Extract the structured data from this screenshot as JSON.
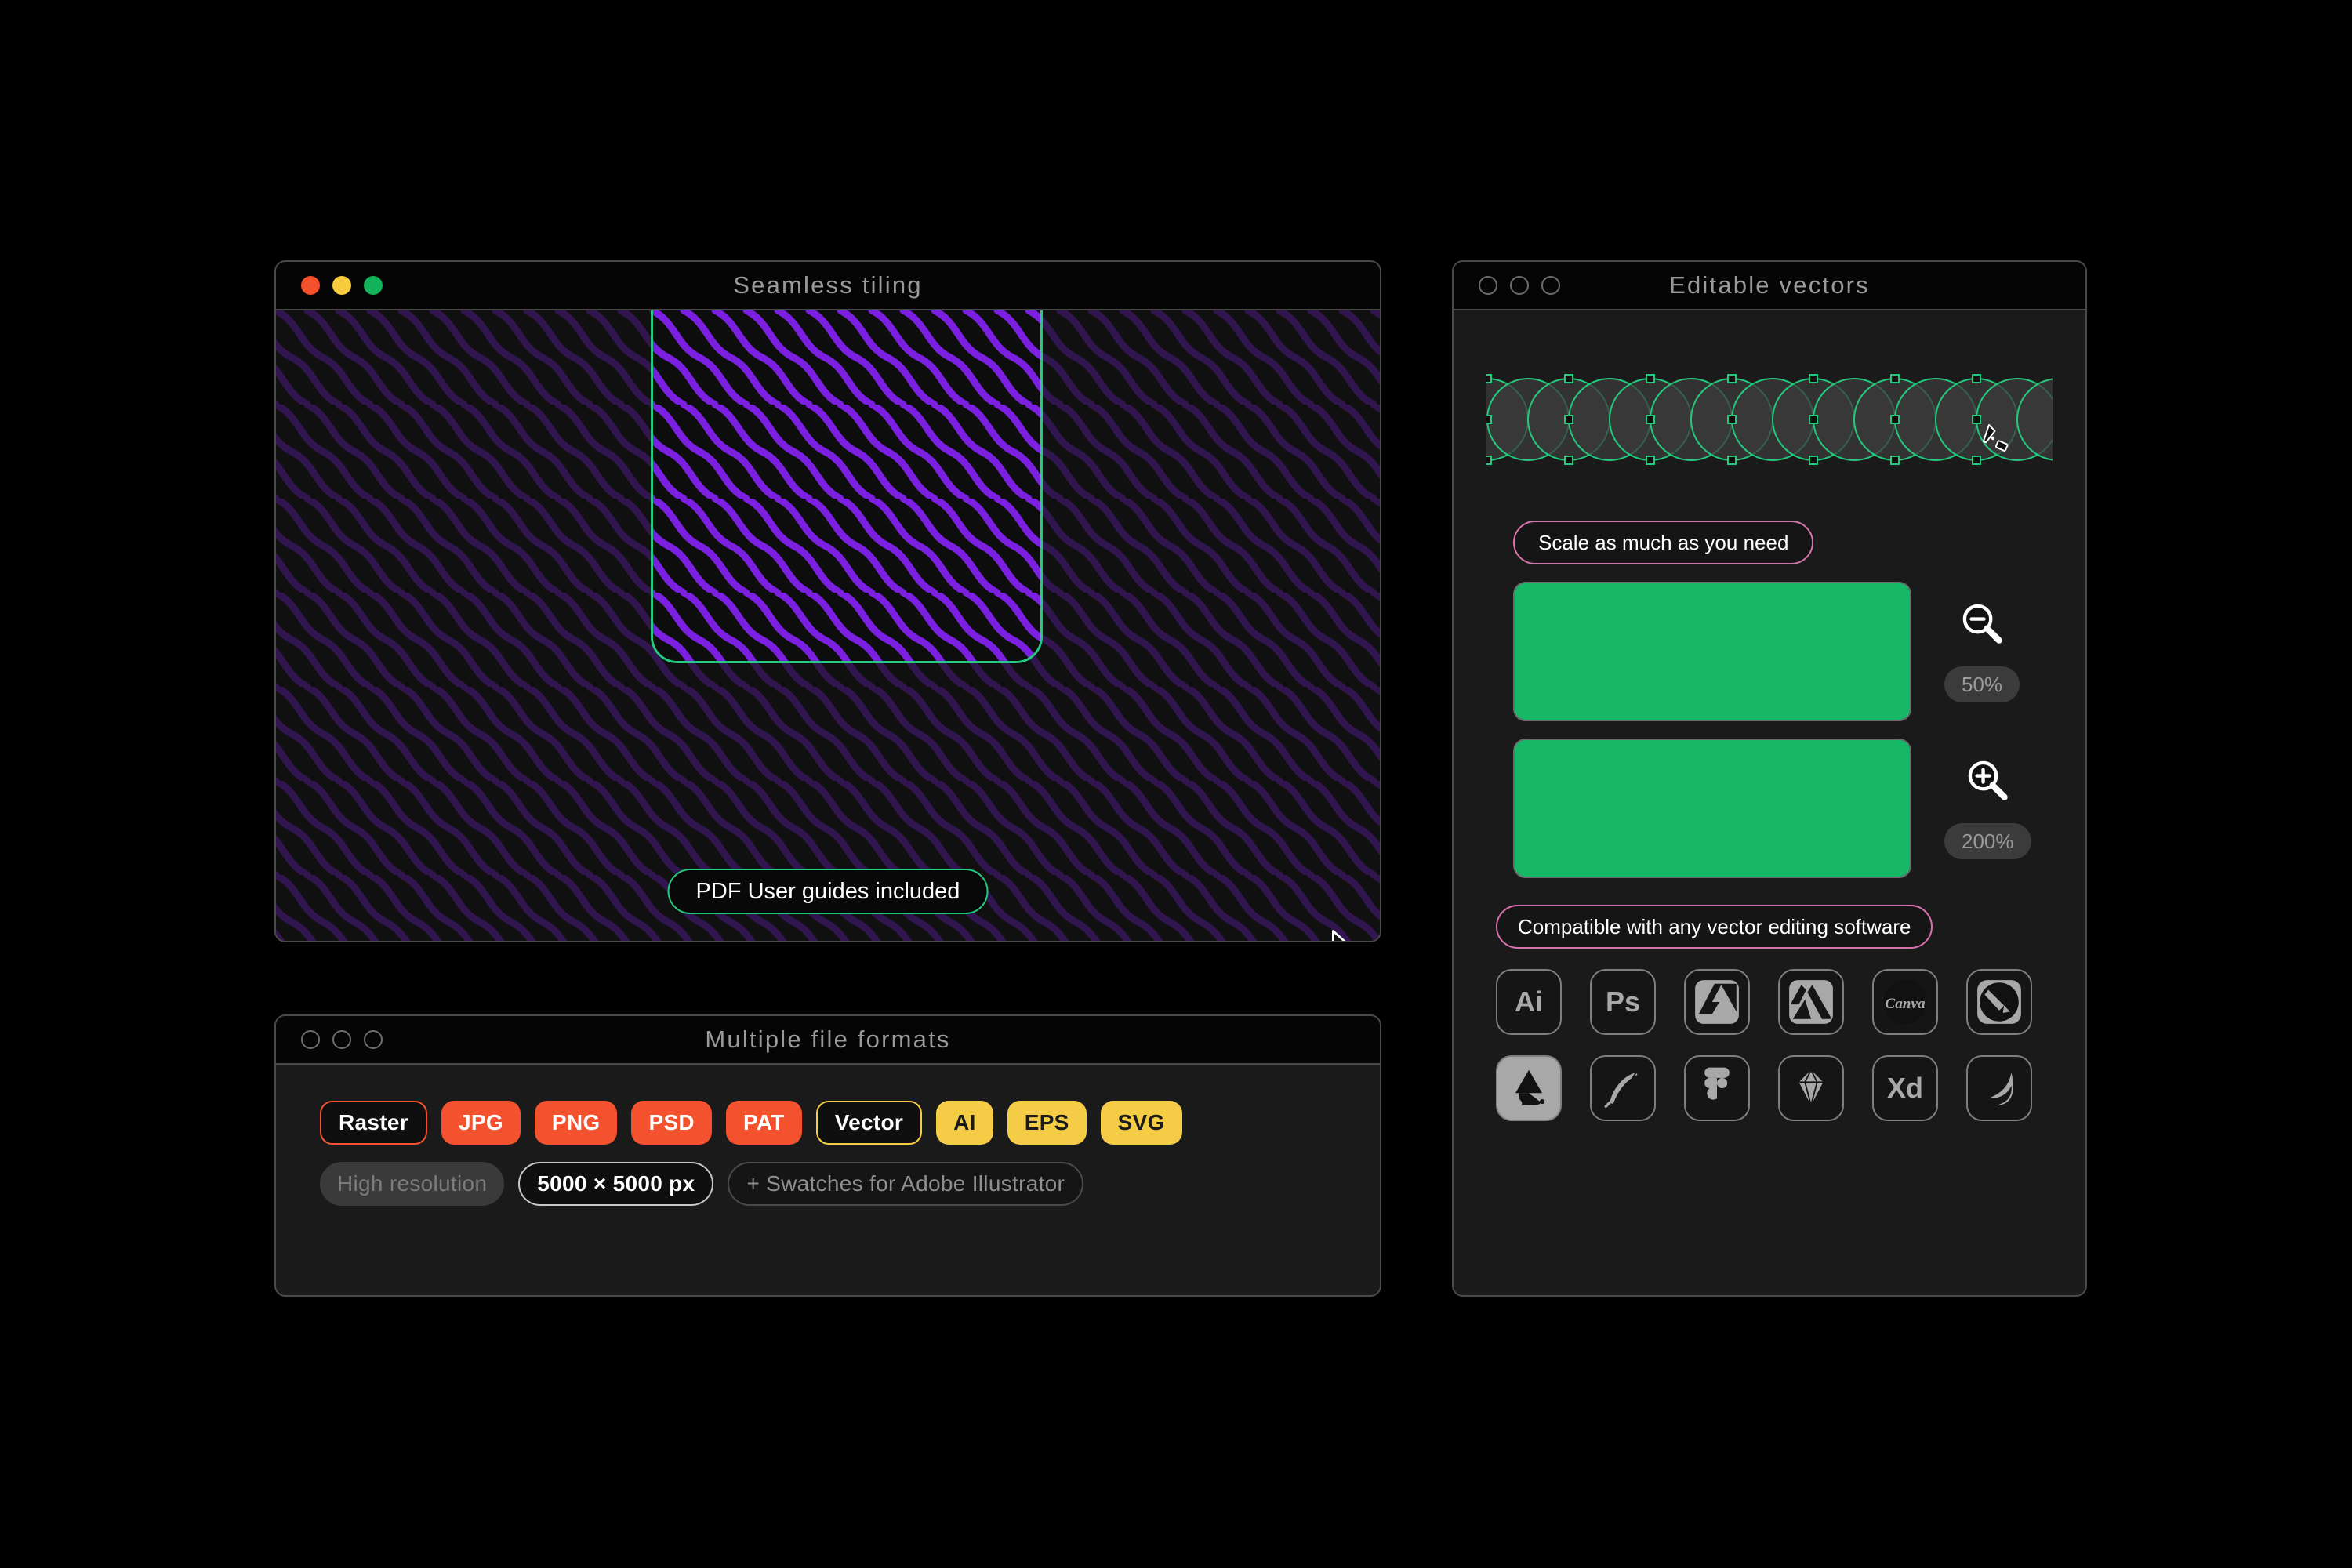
{
  "theme": {
    "background": "#000000",
    "window_bg": "#1a1a1a",
    "window_border": "#4a4a4a",
    "titlebar_bg": "#050505",
    "accent_green": "#24c97e",
    "accent_pink": "#d972ae",
    "accent_orange": "#f4522e",
    "accent_yellow": "#f5cc45",
    "pattern_purple": "#7b1fe0",
    "pattern_green": "#16b866"
  },
  "windows": {
    "tiling": {
      "title": "Seamless tiling",
      "lights": [
        "red",
        "yellow",
        "green"
      ],
      "badge": "PDF User guides included",
      "cursor": "arrow-cursor"
    },
    "formats": {
      "title": "Multiple file formats",
      "lights": [
        "hollow",
        "hollow",
        "hollow"
      ],
      "row1": [
        {
          "label": "Raster",
          "style": "raster-out"
        },
        {
          "label": "JPG",
          "style": "raster-fill"
        },
        {
          "label": "PNG",
          "style": "raster-fill"
        },
        {
          "label": "PSD",
          "style": "raster-fill"
        },
        {
          "label": "PAT",
          "style": "raster-fill"
        },
        {
          "label": "Vector",
          "style": "vector-out"
        },
        {
          "label": "AI",
          "style": "vector-fill"
        },
        {
          "label": "EPS",
          "style": "vector-fill"
        },
        {
          "label": "SVG",
          "style": "vector-fill"
        }
      ],
      "row2": [
        {
          "label": "High resolution",
          "style": "grey-fill"
        },
        {
          "label": "5000 × 5000 px",
          "style": "white-out"
        },
        {
          "label": "+ Swatches for Adobe Illustrator",
          "style": "grey-out"
        }
      ]
    },
    "vectors": {
      "title": "Editable vectors",
      "lights": [
        "hollow",
        "hollow",
        "hollow"
      ],
      "path_art_name": "editable-vector-path-preview",
      "pen_cursor": "pen-tool-cursor",
      "scale_badge": "Scale as much as you need",
      "compat_badge": "Compatible with any vector editing software",
      "zoom_levels": [
        {
          "label": "50%",
          "icon": "zoom-out-icon",
          "scale": "small"
        },
        {
          "label": "200%",
          "icon": "zoom-in-icon",
          "scale": "large"
        }
      ],
      "apps_row1": [
        "Ai",
        "Ps",
        "Affinity Designer",
        "Affinity Photo",
        "Canva",
        "Vectornator"
      ],
      "apps_row2": [
        "Inkscape",
        "Gravit Designer",
        "Figma",
        "Sketch",
        "Xd",
        "Procreate"
      ]
    }
  }
}
